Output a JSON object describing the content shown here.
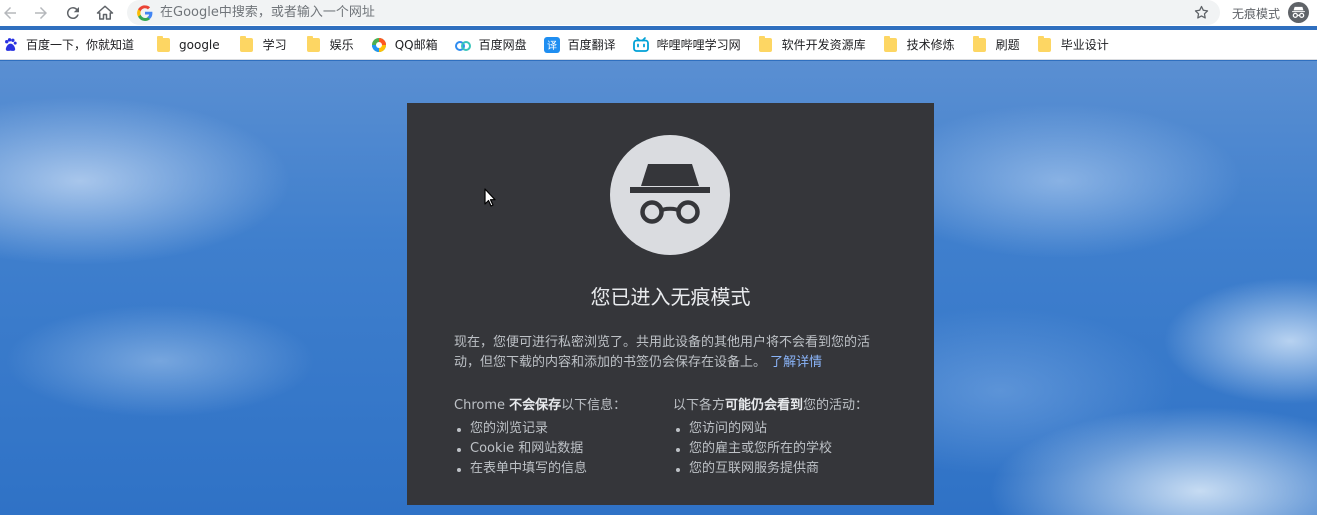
{
  "omnibox": {
    "placeholder": "在Google中搜索，或者输入一个网址"
  },
  "profile": {
    "label": "无痕模式"
  },
  "bookmarks": [
    {
      "label": "百度一下，你就知道",
      "icon": "baidu-paw-icon"
    },
    {
      "label": "google",
      "icon": "folder-icon"
    },
    {
      "label": "学习",
      "icon": "folder-icon"
    },
    {
      "label": "娱乐",
      "icon": "folder-icon"
    },
    {
      "label": "QQ邮箱",
      "icon": "qq-mail-icon"
    },
    {
      "label": "百度网盘",
      "icon": "baidu-netdisk-icon"
    },
    {
      "label": "百度翻译",
      "icon": "translate-icon"
    },
    {
      "label": "哔哩哔哩学习网",
      "icon": "bilibili-icon"
    },
    {
      "label": "软件开发资源库",
      "icon": "folder-icon"
    },
    {
      "label": "技术修炼",
      "icon": "folder-icon"
    },
    {
      "label": "刷题",
      "icon": "folder-icon"
    },
    {
      "label": "毕业设计",
      "icon": "folder-icon"
    }
  ],
  "incognito": {
    "title": "您已进入无痕模式",
    "intro": "现在，您便可进行私密浏览了。共用此设备的其他用户将不会看到您的活动，但您下载的内容和添加的书签仍会保存在设备上。",
    "learn_more": "了解详情",
    "not_saved": {
      "prefix": "Chrome ",
      "bold": "不会保存",
      "suffix": "以下信息：",
      "items": [
        "您的浏览记录",
        "Cookie 和网站数据",
        "在表单中填写的信息"
      ]
    },
    "may_see": {
      "prefix": "以下各方",
      "bold": "可能仍会看到",
      "suffix": "您的活动：",
      "items": [
        "您访问的网站",
        "您的雇主或您所在的学校",
        "您的互联网服务提供商"
      ]
    }
  },
  "colors": {
    "card_bg": "#35363a",
    "link": "#8ab4f8",
    "folder": "#fdd663",
    "sky": "#3f7fcd"
  }
}
